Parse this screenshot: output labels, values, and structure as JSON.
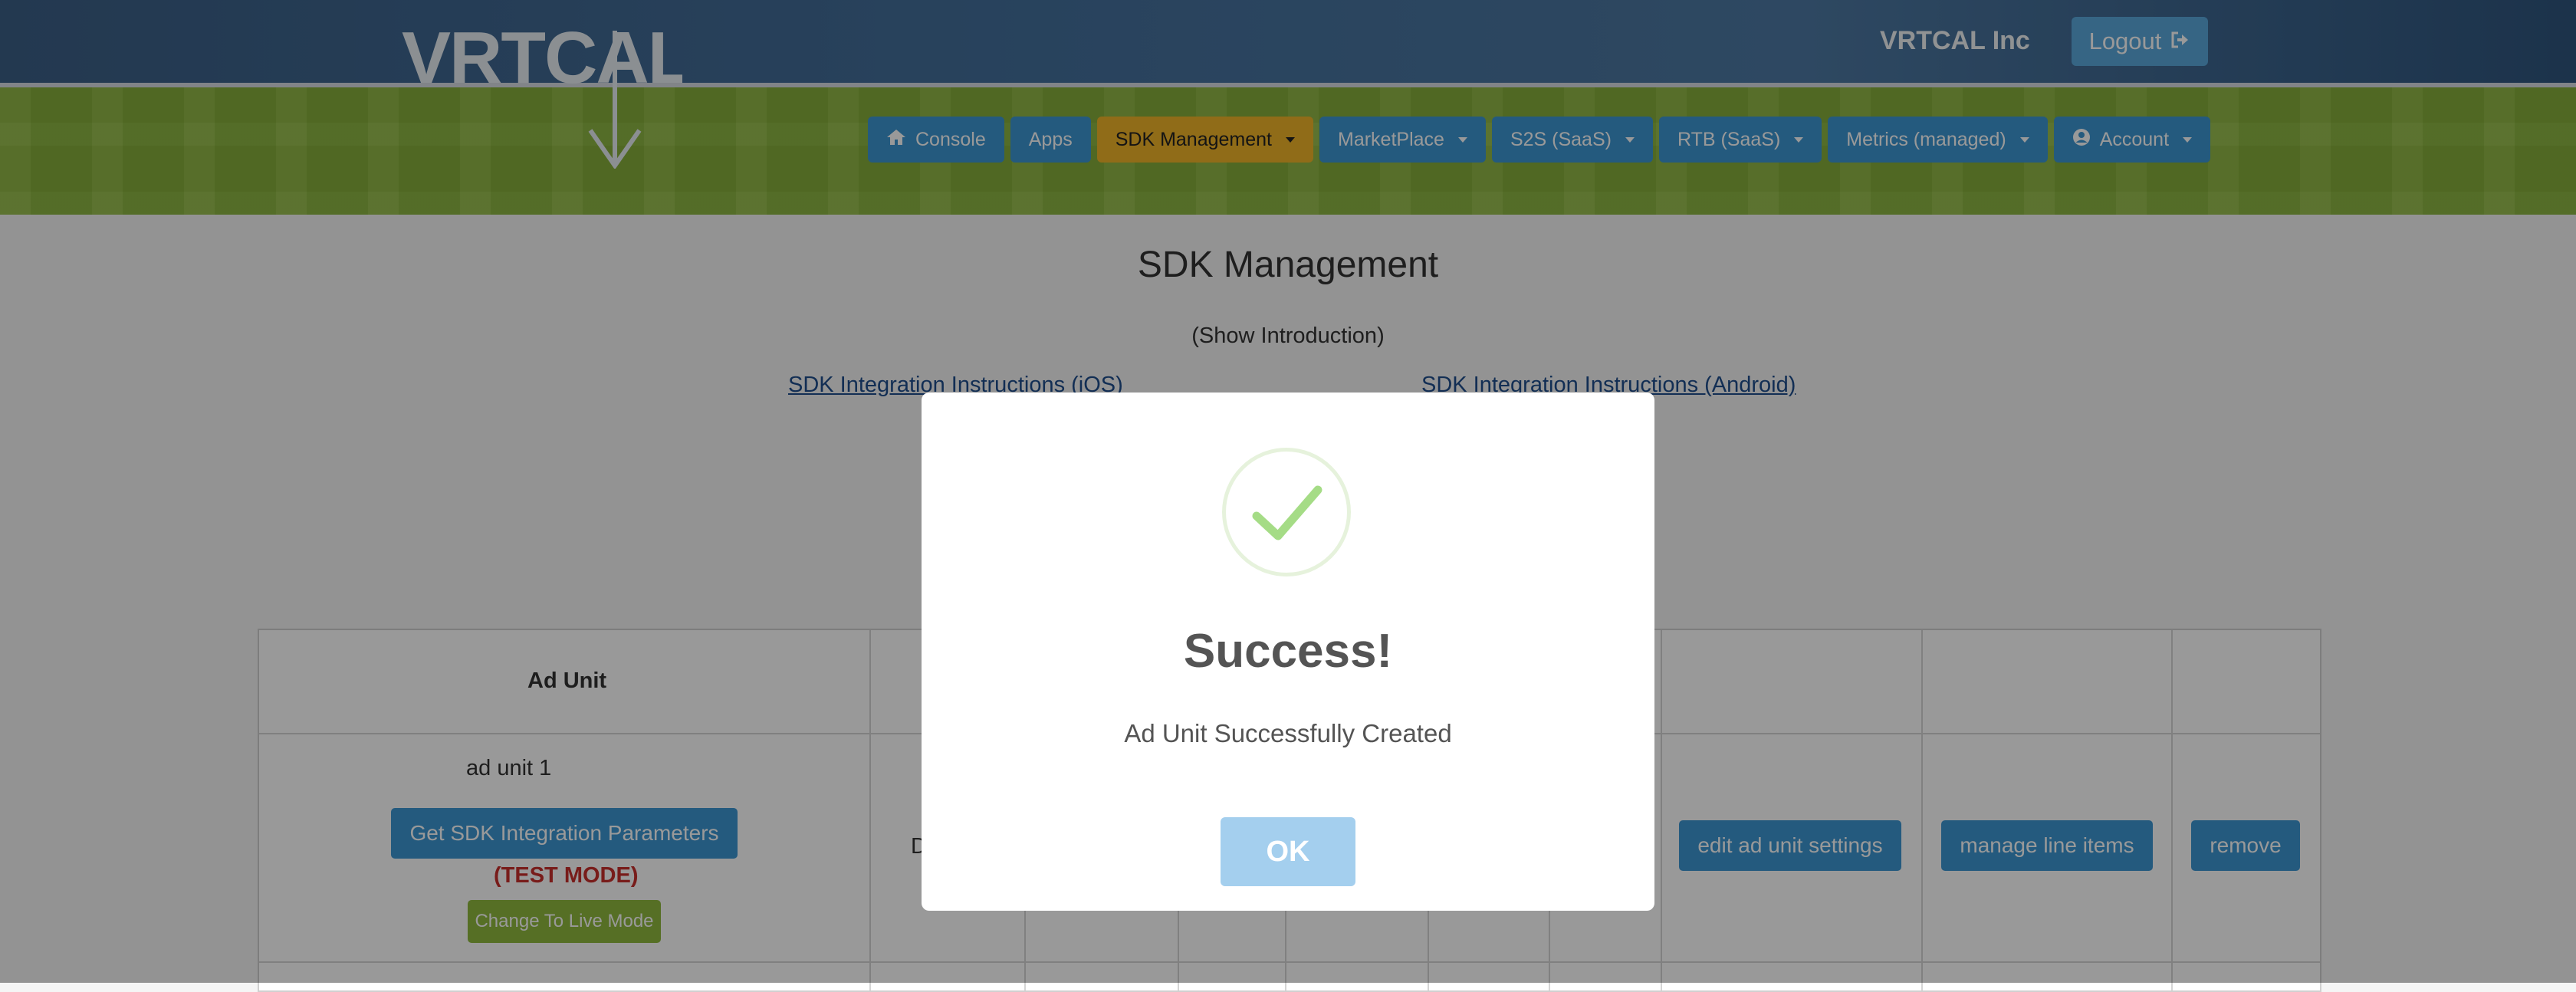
{
  "header": {
    "logo_text": "VRTCAL",
    "company": "VRTCAL Inc",
    "logout_label": "Logout"
  },
  "nav": {
    "items": [
      {
        "label": "Console",
        "icon": "home-icon"
      },
      {
        "label": "Apps"
      },
      {
        "label": "SDK Management",
        "active": true
      },
      {
        "label": "MarketPlace"
      },
      {
        "label": "S2S (SaaS)"
      },
      {
        "label": "RTB (SaaS)"
      },
      {
        "label": "Metrics (managed)"
      },
      {
        "label": "Account",
        "icon": "user-circle-icon"
      }
    ]
  },
  "page": {
    "title": "SDK Management",
    "show_intro": "(Show Introduction)",
    "ios_link": "SDK Integration Instructions (iOS)",
    "android_link": "SDK Integration Instructions (Android)"
  },
  "table": {
    "header_ad_unit": "Ad Unit",
    "row1": {
      "name": "ad unit 1",
      "get_params_label": "Get SDK Integration Parameters",
      "test_mode": "(TEST MODE)",
      "live_mode_label": "Change To Live Mode",
      "col2_partial": "D",
      "edit_label": "edit ad unit settings",
      "manage_label": "manage line items",
      "remove_label": "remove"
    }
  },
  "modal": {
    "title": "Success!",
    "message": "Ad Unit Successfully Created",
    "ok_label": "OK"
  },
  "colors": {
    "header_blue": "#44709c",
    "brand_green": "#8fba3f",
    "button_blue": "#3d97d3",
    "active_nav": "#f0b429",
    "test_mode_red": "#c9302c",
    "success_green": "#a5dc86"
  }
}
